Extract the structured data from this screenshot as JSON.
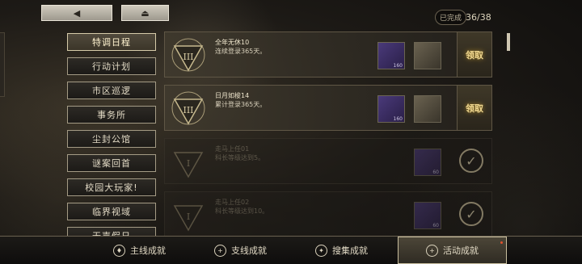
{
  "header": {
    "back_glyph": "◀",
    "collapse_glyph": "⏏",
    "completed_label": "已完成",
    "completed_count": "36/38"
  },
  "sidebar": {
    "items": [
      {
        "label": "特调日程",
        "active": true
      },
      {
        "label": "行动计划",
        "active": false
      },
      {
        "label": "市区巡逻",
        "active": false
      },
      {
        "label": "事务所",
        "active": false
      },
      {
        "label": "尘封公馆",
        "active": false
      },
      {
        "label": "谜案回首",
        "active": false
      },
      {
        "label": "校园大玩家!",
        "active": false
      },
      {
        "label": "临界视域",
        "active": false
      },
      {
        "label": "无声假日",
        "active": false
      }
    ]
  },
  "achievements": [
    {
      "title": "全年无休10",
      "desc": "连续登录365天。",
      "emblem": "III",
      "state": "claimable",
      "claim_label": "领取",
      "rewards": [
        {
          "type": "vinyl",
          "qty": "160"
        },
        {
          "type": "box",
          "qty": ""
        }
      ]
    },
    {
      "title": "日月如梭14",
      "desc": "累计登录365天。",
      "emblem": "III",
      "state": "claimable",
      "claim_label": "领取",
      "rewards": [
        {
          "type": "vinyl",
          "qty": "160"
        },
        {
          "type": "box",
          "qty": ""
        }
      ]
    },
    {
      "title": "走马上任01",
      "desc": "科长等级达到5。",
      "emblem": "I",
      "state": "done",
      "claim_label": "",
      "rewards": [
        {
          "type": "vinyl",
          "qty": "60"
        }
      ]
    },
    {
      "title": "走马上任02",
      "desc": "科长等级达到10。",
      "emblem": "I",
      "state": "done",
      "claim_label": "",
      "rewards": [
        {
          "type": "vinyl",
          "qty": "60"
        }
      ]
    }
  ],
  "bottom_tabs": [
    {
      "label": "主线成就",
      "icon": "main-achievement-icon",
      "active": false
    },
    {
      "label": "支线成就",
      "icon": "side-achievement-icon",
      "active": false
    },
    {
      "label": "搜集成就",
      "icon": "collect-achievement-icon",
      "active": false
    },
    {
      "label": "活动成就",
      "icon": "event-achievement-icon",
      "active": true,
      "badge": true
    }
  ]
}
